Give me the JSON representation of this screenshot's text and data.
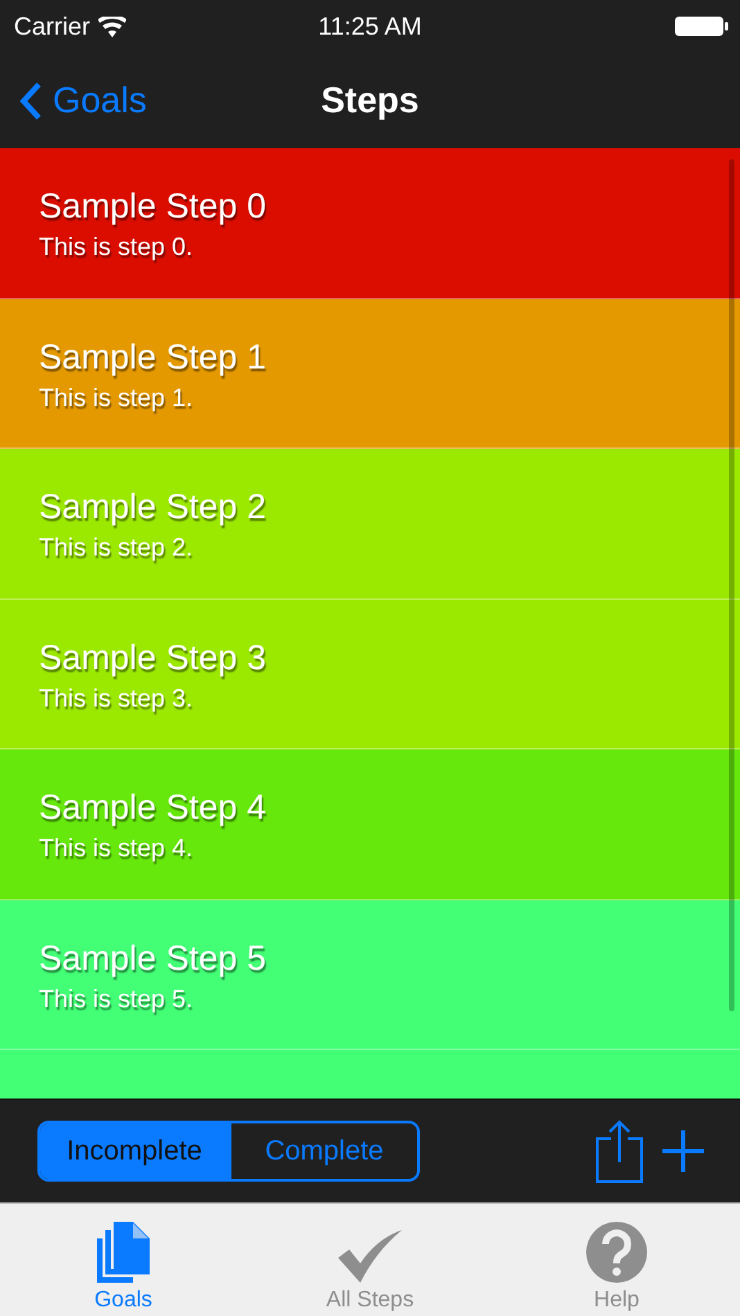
{
  "status_bar": {
    "carrier": "Carrier",
    "time": "11:25 AM"
  },
  "nav_bar": {
    "back": "Goals",
    "title": "Steps"
  },
  "steps": [
    {
      "title": "Sample Step 0",
      "subtitle": "This is step 0.",
      "color": "#db0d00"
    },
    {
      "title": "Sample Step 1",
      "subtitle": "This is step 1.",
      "color": "#e59900"
    },
    {
      "title": "Sample Step 2",
      "subtitle": "This is step 2.",
      "color": "#9be800"
    },
    {
      "title": "Sample Step 3",
      "subtitle": "This is step 3.",
      "color": "#9be800"
    },
    {
      "title": "Sample Step 4",
      "subtitle": "This is step 4.",
      "color": "#66e80c"
    },
    {
      "title": "Sample Step 5",
      "subtitle": "This is step 5.",
      "color": "#42ff75"
    },
    {
      "color": "#42ff75"
    }
  ],
  "segments": [
    {
      "label": "Incomplete",
      "selected": true
    },
    {
      "label": "Complete",
      "selected": false
    }
  ],
  "tabs": [
    {
      "label": "Goals",
      "kind": "pages",
      "selected": true
    },
    {
      "label": "All Steps",
      "kind": "check",
      "selected": false
    },
    {
      "label": "Help",
      "kind": "help",
      "selected": false
    }
  ]
}
